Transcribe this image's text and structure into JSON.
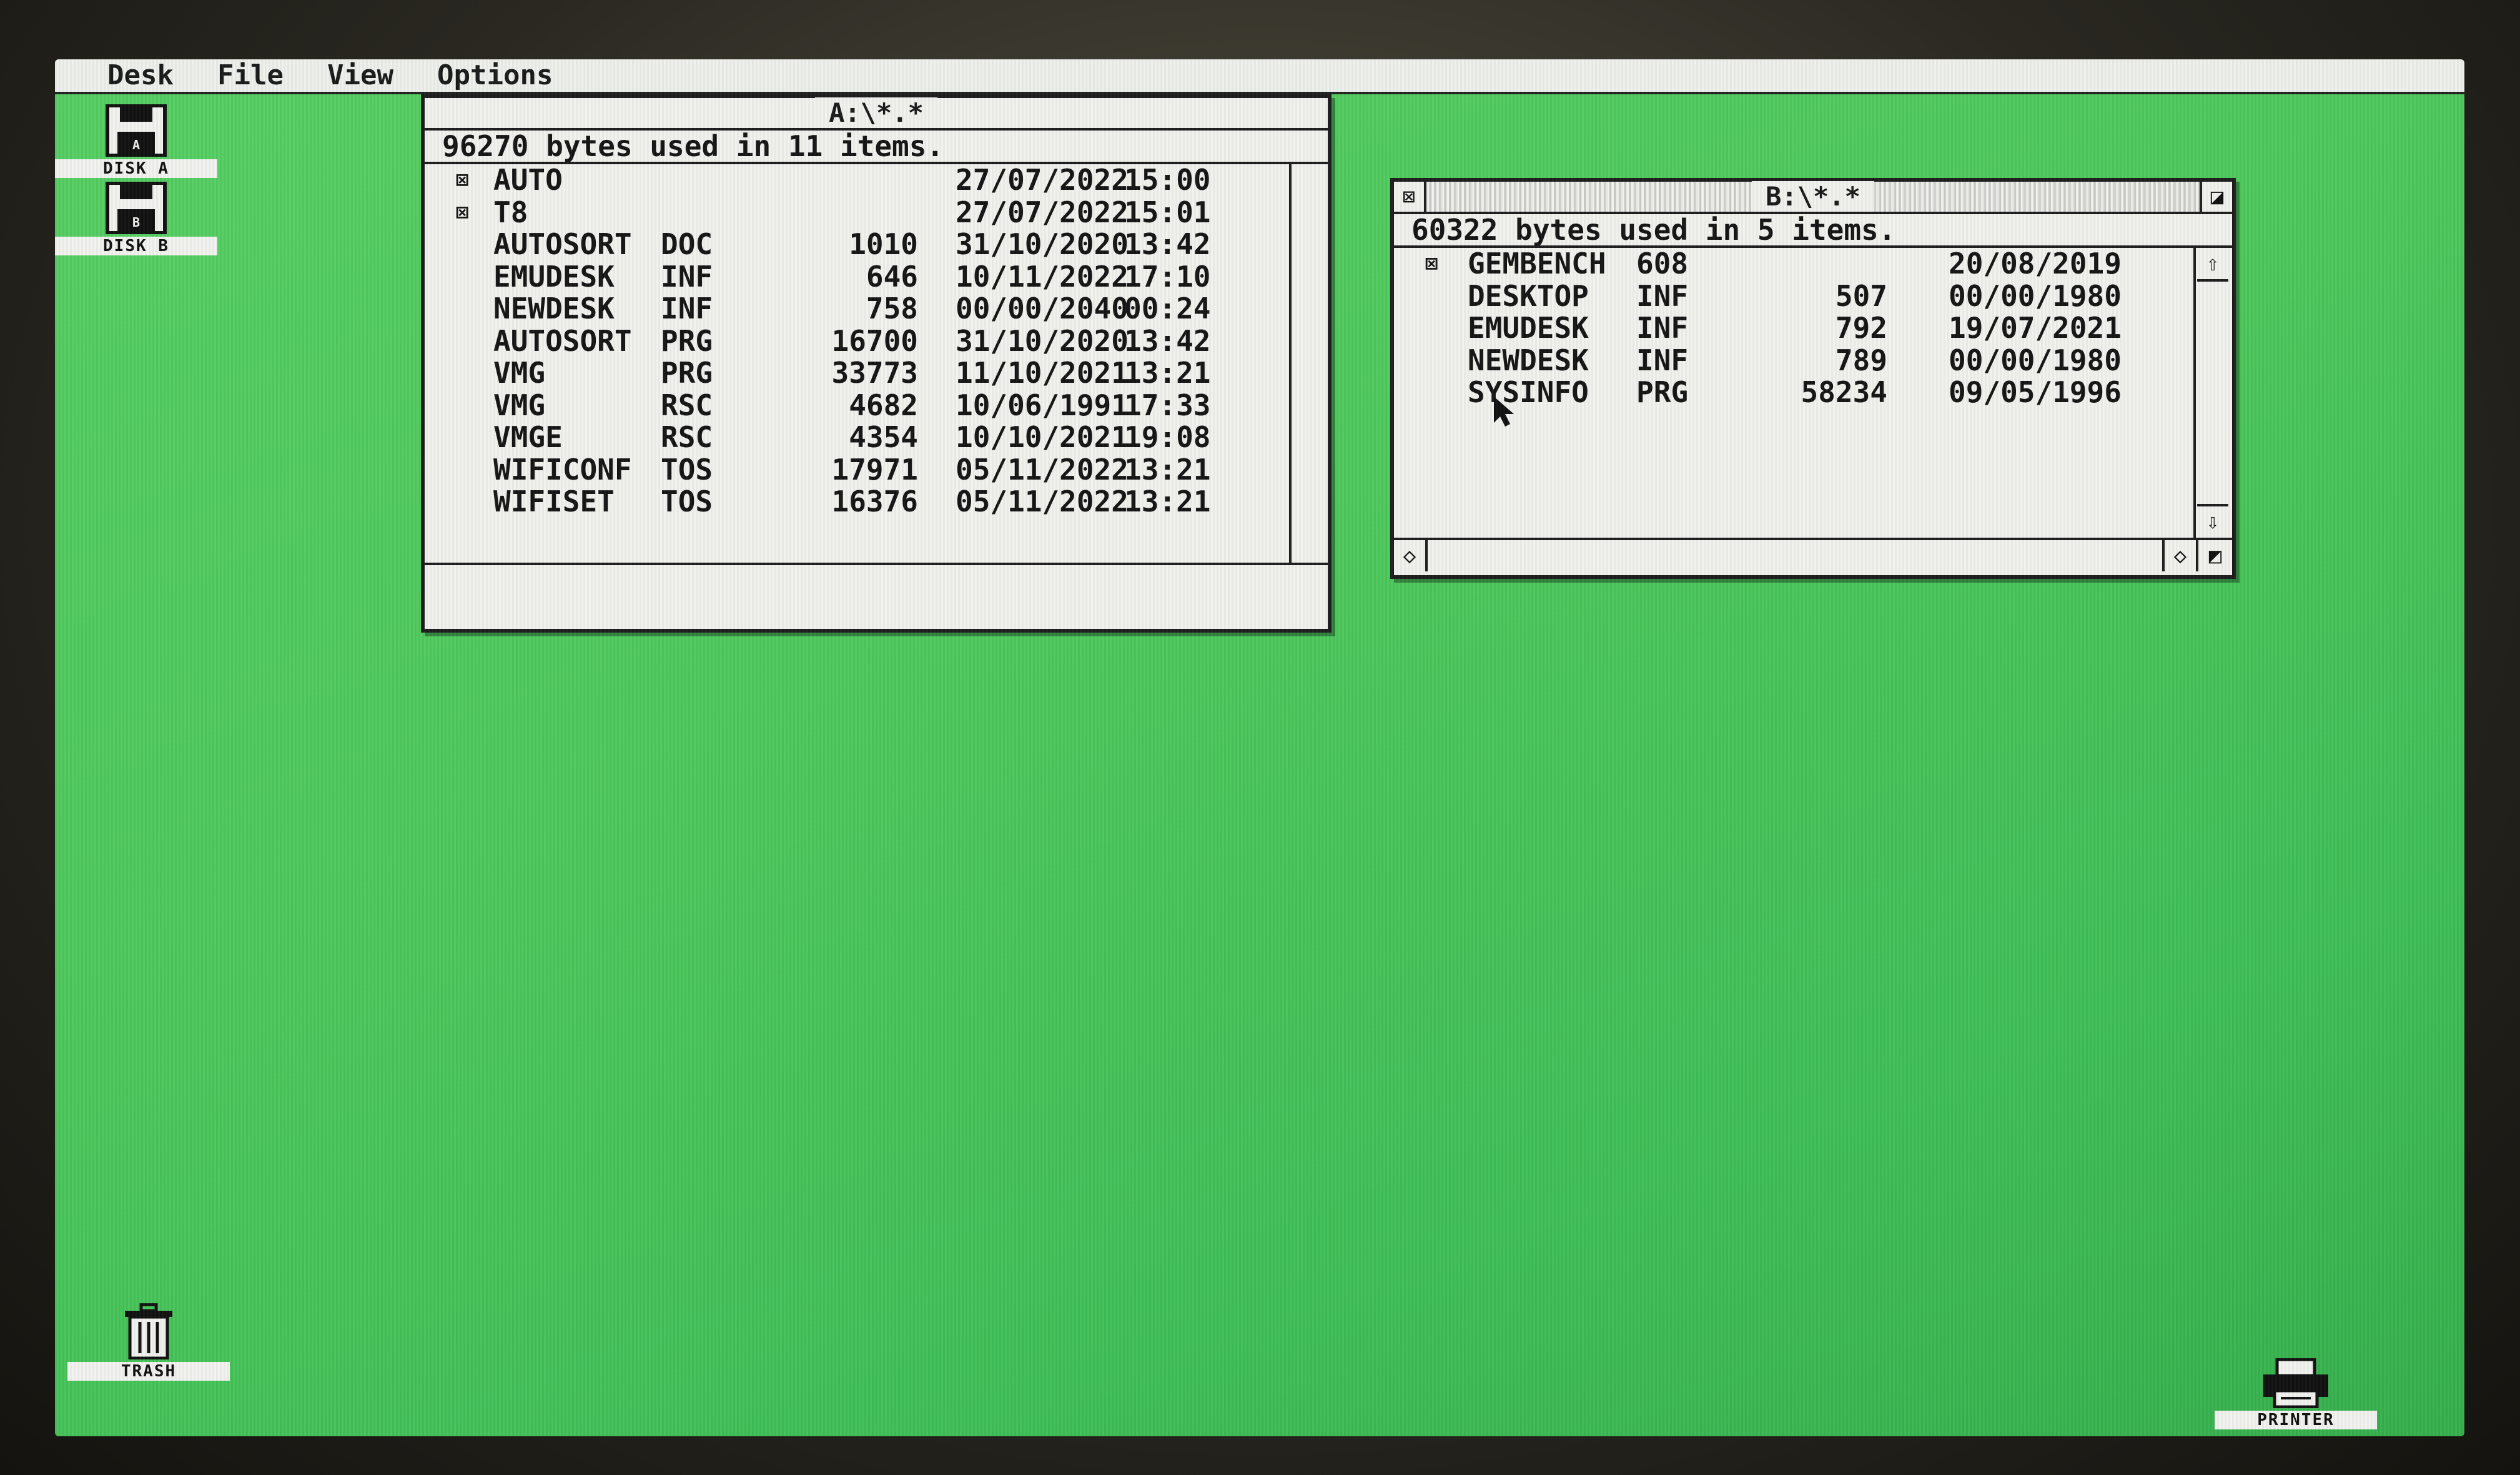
{
  "menu": [
    "Desk",
    "File",
    "View",
    "Options"
  ],
  "desktop_icons": {
    "disk_a": "DISK A",
    "disk_b": "DISK B",
    "trash": "TRASH",
    "printer": "PRINTER"
  },
  "window_a": {
    "title": "A:\\*.*",
    "info": "96270 bytes used in 11 items.",
    "rows": [
      {
        "folder": true,
        "name": "AUTO",
        "ext": "",
        "size": "",
        "date": "27/07/2022",
        "time": "15:00"
      },
      {
        "folder": true,
        "name": "T8",
        "ext": "",
        "size": "",
        "date": "27/07/2022",
        "time": "15:01"
      },
      {
        "folder": false,
        "name": "AUTOSORT",
        "ext": "DOC",
        "size": "1010",
        "date": "31/10/2020",
        "time": "13:42"
      },
      {
        "folder": false,
        "name": "EMUDESK",
        "ext": "INF",
        "size": "646",
        "date": "10/11/2022",
        "time": "17:10"
      },
      {
        "folder": false,
        "name": "NEWDESK",
        "ext": "INF",
        "size": "758",
        "date": "00/00/2040",
        "time": "00:24"
      },
      {
        "folder": false,
        "name": "AUTOSORT",
        "ext": "PRG",
        "size": "16700",
        "date": "31/10/2020",
        "time": "13:42"
      },
      {
        "folder": false,
        "name": "VMG",
        "ext": "PRG",
        "size": "33773",
        "date": "11/10/2021",
        "time": "13:21"
      },
      {
        "folder": false,
        "name": "VMG",
        "ext": "RSC",
        "size": "4682",
        "date": "10/06/1991",
        "time": "17:33"
      },
      {
        "folder": false,
        "name": "VMGE",
        "ext": "RSC",
        "size": "4354",
        "date": "10/10/2021",
        "time": "19:08"
      },
      {
        "folder": false,
        "name": "WIFICONF",
        "ext": "TOS",
        "size": "17971",
        "date": "05/11/2022",
        "time": "13:21"
      },
      {
        "folder": false,
        "name": "WIFISET",
        "ext": "TOS",
        "size": "16376",
        "date": "05/11/2022",
        "time": "13:21"
      }
    ]
  },
  "window_b": {
    "title": "B:\\*.*",
    "info": "60322 bytes used in 5 items.",
    "rows": [
      {
        "folder": true,
        "name": "GEMBENCH",
        "ext": "608",
        "size": "",
        "date": "20/08/2019"
      },
      {
        "folder": false,
        "name": "DESKTOP",
        "ext": "INF",
        "size": "507",
        "date": "00/00/1980"
      },
      {
        "folder": false,
        "name": "EMUDESK",
        "ext": "INF",
        "size": "792",
        "date": "19/07/2021"
      },
      {
        "folder": false,
        "name": "NEWDESK",
        "ext": "INF",
        "size": "789",
        "date": "00/00/1980"
      },
      {
        "folder": false,
        "name": "SYSINFO",
        "ext": "PRG",
        "size": "58234",
        "date": "09/05/1996"
      }
    ]
  },
  "icons": {
    "close": "close-box-icon",
    "fuller": "fuller-box-icon",
    "up": "scroll-up-arrow-icon",
    "down": "scroll-down-arrow-icon",
    "left": "scroll-left-arrow-icon",
    "right": "scroll-right-arrow-icon",
    "size": "size-box-icon"
  },
  "colors": {
    "desktop": "#4fc95d",
    "window": "#f1f2ee",
    "text": "#151515"
  }
}
